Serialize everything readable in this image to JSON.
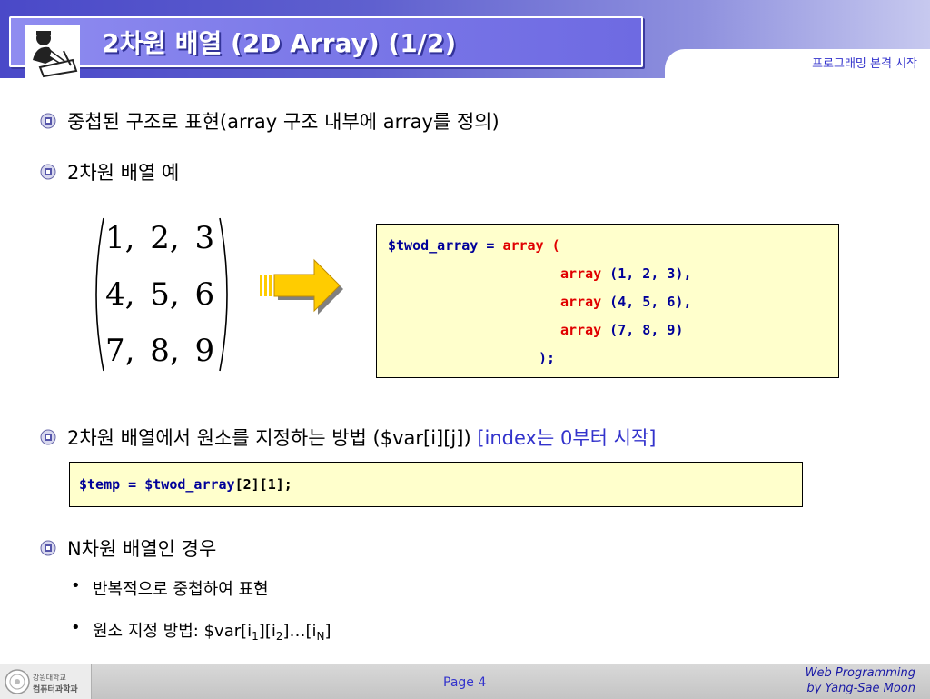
{
  "header": {
    "title": "2차원 배열 (2D Array) (1/2)",
    "subtitle": "프로그래밍 본격 시작"
  },
  "bullets": {
    "b1": {
      "text_a": "중첩된 구조로 표현",
      "text_b": "(array 구조 내부에 array를 정의)"
    },
    "b2": {
      "text": "2차원 배열 예"
    },
    "b3": {
      "text_a": "2차원 배열에서 원소를 지정하는 방법 ($var[i][j]) ",
      "text_b": "[index는 0부터 시작]"
    },
    "b4": {
      "text": "N차원 배열인 경우"
    },
    "sub1": {
      "text": "반복적으로 중첩하여 표현"
    },
    "sub2": {
      "prefix": "원소 지정 방법: $var[i",
      "s1": "1",
      "m1": "][i",
      "s2": "2",
      "m2": "]…[i",
      "s3": "N",
      "end": "]"
    }
  },
  "matrix": {
    "rows": [
      "1,  2,  3",
      "4,  5,  6",
      "7,  8,  9"
    ]
  },
  "code1": {
    "l1_var": "$twod_array",
    "l1_eq": " = ",
    "l1_kw": "array",
    "l1_paren": " (",
    "l2_kw": "array",
    "l2_args": " (1, 2, 3),",
    "l3_kw": "array",
    "l3_args": " (4, 5, 6),",
    "l4_kw": "array",
    "l4_args": " (7, 8, 9)",
    "l5": ");"
  },
  "code2": {
    "var_temp": "$temp",
    "eq": " = ",
    "var_arr": "$twod_array",
    "idx": "[2][1];"
  },
  "footer": {
    "logo_line1": "강원대학교",
    "logo_line2": "컴퓨터과학과",
    "page": "Page 4",
    "credit_line1": "Web Programming",
    "credit_line2": "by Yang-Sae Moon"
  },
  "colors": {
    "header_blue": "#4a49c8",
    "accent_blue": "#3333cc",
    "code_bg": "#ffffcc",
    "code_keyword": "#e00000",
    "code_variable": "#000099",
    "arrow_yellow": "#ffcc00"
  }
}
